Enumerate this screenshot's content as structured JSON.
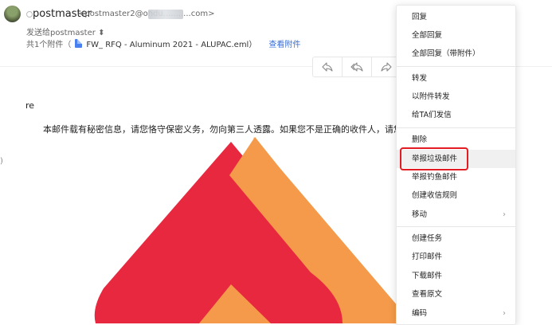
{
  "header": {
    "sender_name": "postmaster",
    "sender_email": "<postmaster2@ohdu...........com>",
    "sent_to": "发送给postmaster",
    "sent_to_chevron": "⬍",
    "attachment_prefix": "共1个附件（",
    "attachment_name": "FW_ RFQ - Aluminum 2021 - ALUPAC.eml）",
    "view_attachment": "查看附件"
  },
  "toolbar": {
    "reply_icon": "reply-icon",
    "reply_all_icon": "reply-all-icon",
    "forward_icon": "forward-icon"
  },
  "body": {
    "re": "re",
    "notice": "本邮件载有秘密信息，请您恪守保密义务，勿向第三人透露。如果您不是正确的收件人，请您立即"
  },
  "menu": {
    "items": [
      {
        "label": "回复"
      },
      {
        "label": "全部回复"
      },
      {
        "label": "全部回复（带附件）"
      },
      {
        "label": "转发"
      },
      {
        "label": "以附件转发"
      },
      {
        "label": "给TA们发信"
      },
      {
        "label": "删除"
      },
      {
        "label": "举报垃圾邮件"
      },
      {
        "label": "举报钓鱼邮件"
      },
      {
        "label": "创建收信规则"
      },
      {
        "label": "移动",
        "has_submenu": true
      },
      {
        "label": "创建任务"
      },
      {
        "label": "打印邮件"
      },
      {
        "label": "下载邮件"
      },
      {
        "label": "查看原文"
      },
      {
        "label": "编码",
        "has_submenu": true
      }
    ],
    "submenu_chevron": "›"
  },
  "colors": {
    "link": "#3b6fd6",
    "highlight_border": "#e31b23",
    "logo_red": "#e8283f",
    "logo_orange": "#f59a4a"
  }
}
